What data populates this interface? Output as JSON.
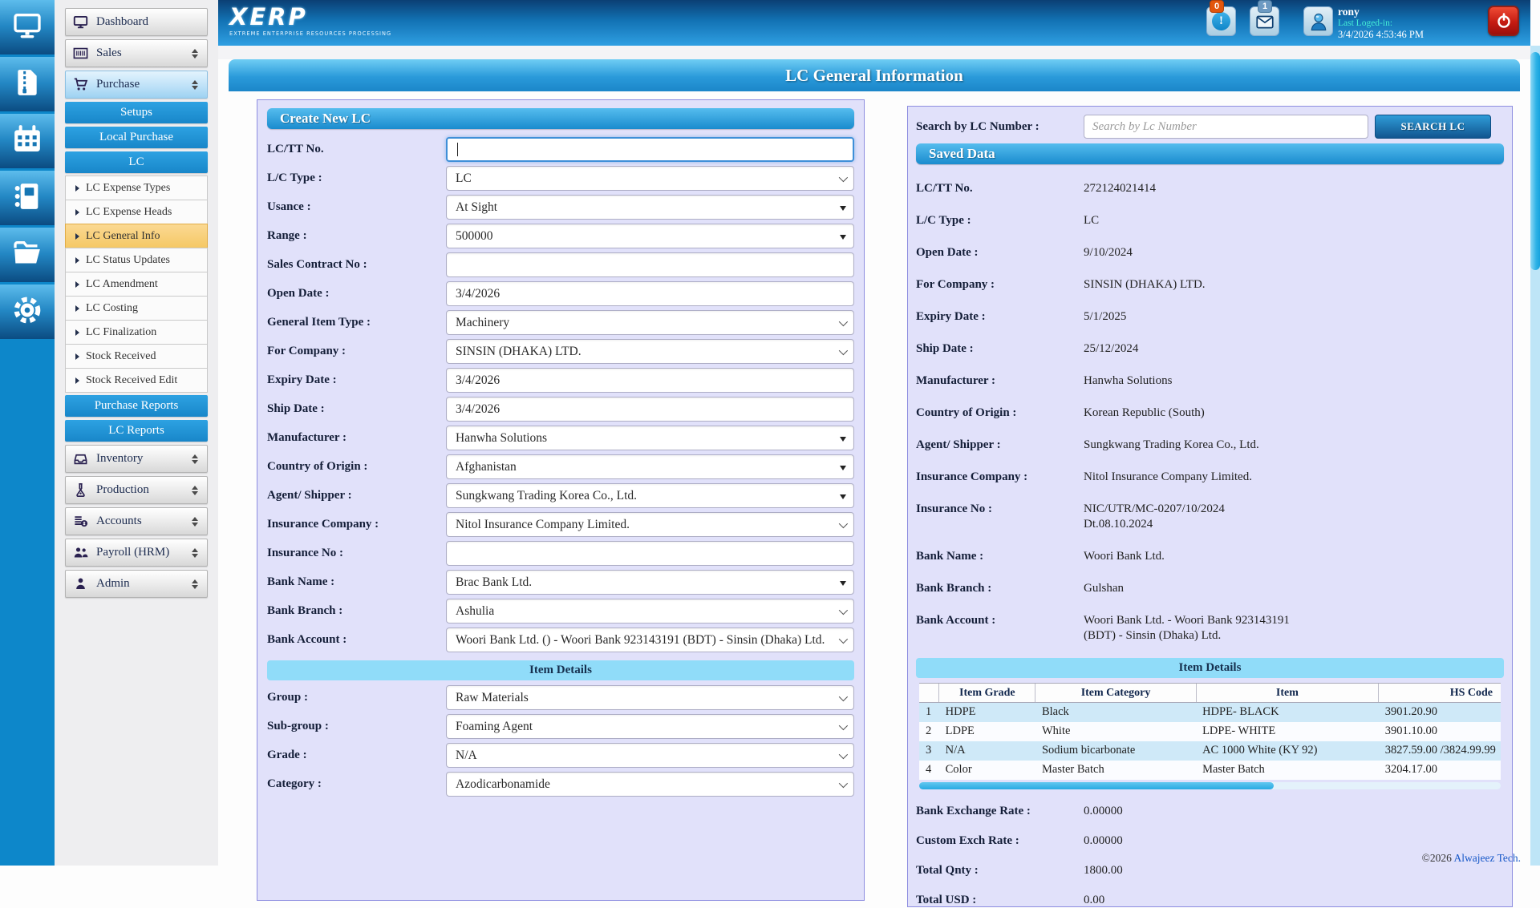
{
  "header": {
    "logo_title": "XERP",
    "logo_subtitle": "EXTREME ENTERPRISE RESOURCES PROCESSING",
    "notification_badge": "0",
    "mail_badge": "1",
    "user": {
      "name": "rony",
      "last_login_label": "Last Loged-in:",
      "last_login_time": "3/4/2026 4:53:46 PM"
    }
  },
  "page_title": "LC General Information",
  "rail_icons": [
    "desktop-icon",
    "zip-file-icon",
    "calendar-icon",
    "notebook-icon",
    "folder-icon",
    "gear-icon"
  ],
  "sidebar": {
    "items": [
      {
        "kind": "module",
        "icon": "monitor-icon",
        "label": "Dashboard",
        "expandable": false
      },
      {
        "kind": "module",
        "icon": "barcode-icon",
        "label": "Sales",
        "expandable": true
      },
      {
        "kind": "module",
        "icon": "cart-icon",
        "label": "Purchase",
        "expandable": true,
        "active": true
      },
      {
        "kind": "section",
        "label": "Setups"
      },
      {
        "kind": "section",
        "label": "Local Purchase"
      },
      {
        "kind": "section",
        "label": "LC"
      },
      {
        "kind": "sub",
        "label": "LC Expense Types"
      },
      {
        "kind": "sub",
        "label": "LC Expense Heads"
      },
      {
        "kind": "sub",
        "label": "LC General Info",
        "active": true
      },
      {
        "kind": "sub",
        "label": "LC Status Updates"
      },
      {
        "kind": "sub",
        "label": "LC Amendment"
      },
      {
        "kind": "sub",
        "label": "LC Costing"
      },
      {
        "kind": "sub",
        "label": "LC Finalization"
      },
      {
        "kind": "sub",
        "label": "Stock Received"
      },
      {
        "kind": "sub",
        "label": "Stock Received Edit"
      },
      {
        "kind": "section",
        "label": "Purchase Reports"
      },
      {
        "kind": "section",
        "label": "LC Reports"
      },
      {
        "kind": "module",
        "icon": "inbox-icon",
        "label": "Inventory",
        "expandable": true
      },
      {
        "kind": "module",
        "icon": "flask-icon",
        "label": "Production",
        "expandable": true
      },
      {
        "kind": "module",
        "icon": "coins-icon",
        "label": "Accounts",
        "expandable": true
      },
      {
        "kind": "module",
        "icon": "people-icon",
        "label": "Payroll (HRM)",
        "expandable": true
      },
      {
        "kind": "module",
        "icon": "person-icon",
        "label": "Admin",
        "expandable": true
      }
    ]
  },
  "create_form": {
    "title": "Create New LC",
    "fields": [
      {
        "label": "LC/TT No.",
        "value": "",
        "control": "text",
        "focused": true
      },
      {
        "label": "L/C Type :",
        "value": "LC",
        "control": "select"
      },
      {
        "label": "Usance :",
        "value": "At Sight",
        "control": "combo"
      },
      {
        "label": "Range :",
        "value": "500000",
        "control": "combo"
      },
      {
        "label": "Sales Contract No :",
        "value": "",
        "control": "text"
      },
      {
        "label": "Open Date :",
        "value": "3/4/2026",
        "control": "text"
      },
      {
        "label": "General Item Type :",
        "value": "Machinery",
        "control": "select"
      },
      {
        "label": "For Company :",
        "value": "SINSIN (DHAKA) LTD.",
        "control": "select"
      },
      {
        "label": "Expiry Date :",
        "value": "3/4/2026",
        "control": "text"
      },
      {
        "label": "Ship Date :",
        "value": "3/4/2026",
        "control": "text"
      },
      {
        "label": "Manufacturer :",
        "value": "Hanwha Solutions",
        "control": "combo"
      },
      {
        "label": "Country of Origin :",
        "value": "Afghanistan",
        "control": "combo"
      },
      {
        "label": "Agent/ Shipper :",
        "value": "Sungkwang Trading Korea Co., Ltd.",
        "control": "combo"
      },
      {
        "label": "Insurance Company :",
        "value": "Nitol Insurance Company Limited.",
        "control": "select"
      },
      {
        "label": "Insurance No :",
        "value": "",
        "control": "text"
      },
      {
        "label": "Bank Name :",
        "value": "Brac Bank Ltd.",
        "control": "combo"
      },
      {
        "label": "Bank Branch :",
        "value": "Ashulia",
        "control": "select"
      },
      {
        "label": "Bank Account :",
        "value": "Woori Bank Ltd. () - Woori Bank 923143191 (BDT) - Sinsin (Dhaka) Ltd.",
        "control": "select"
      },
      {
        "divider": "Item Details"
      },
      {
        "label": "Group :",
        "value": "Raw Materials",
        "control": "select"
      },
      {
        "label": "Sub-group :",
        "value": "Foaming Agent",
        "control": "select"
      },
      {
        "label": "Grade :",
        "value": "N/A",
        "control": "select"
      },
      {
        "label": "Category :",
        "value": "Azodicarbonamide",
        "control": "select"
      }
    ]
  },
  "search": {
    "label": "Search by LC Number :",
    "placeholder": "Search by Lc Number",
    "button": "SEARCH LC"
  },
  "saved_data": {
    "title": "Saved Data",
    "rows": [
      {
        "label": "LC/TT No.",
        "value": "272124021414"
      },
      {
        "label": "L/C Type :",
        "value": "LC"
      },
      {
        "label": "Open Date :",
        "value": "9/10/2024"
      },
      {
        "label": "For Company :",
        "value": "SINSIN (DHAKA) LTD."
      },
      {
        "label": "Expiry Date :",
        "value": "5/1/2025"
      },
      {
        "label": "Ship Date :",
        "value": "25/12/2024"
      },
      {
        "label": "Manufacturer :",
        "value": "Hanwha Solutions"
      },
      {
        "label": "Country of Origin :",
        "value": "Korean Republic (South)"
      },
      {
        "label": "Agent/ Shipper :",
        "value": "Sungkwang Trading Korea Co., Ltd."
      },
      {
        "label": "Insurance Company :",
        "value": "Nitol Insurance Company Limited."
      },
      {
        "label": "Insurance No :",
        "value": "NIC/UTR/MC-0207/10/2024\nDt.08.10.2024"
      },
      {
        "label": "Bank Name :",
        "value": "Woori Bank Ltd."
      },
      {
        "label": "Bank Branch :",
        "value": "Gulshan"
      },
      {
        "label": "Bank Account :",
        "value": "Woori Bank Ltd. - Woori Bank 923143191\n(BDT) - Sinsin (Dhaka) Ltd."
      }
    ],
    "item_details_title": "Item Details",
    "table": {
      "headers": [
        "",
        "Item Grade",
        "Item Category",
        "Item",
        "HS Code"
      ],
      "rows": [
        [
          "1",
          "HDPE",
          "Black",
          "HDPE- BLACK",
          "3901.20.90"
        ],
        [
          "2",
          "LDPE",
          "White",
          "LDPE- WHITE",
          "3901.10.00"
        ],
        [
          "3",
          "N/A",
          "Sodium bicarbonate",
          "AC 1000 White (KY 92)",
          "3827.59.00 /3824.99.99"
        ],
        [
          "4",
          "Color",
          "Master Batch",
          "Master Batch",
          "3204.17.00"
        ]
      ]
    },
    "totals": [
      {
        "label": "Bank Exchange Rate :",
        "value": "0.00000"
      },
      {
        "label": "Custom Exch Rate :",
        "value": "0.00000"
      },
      {
        "label": "Total Qnty :",
        "value": "1800.00"
      },
      {
        "label": "Total USD :",
        "value": "0.00"
      }
    ]
  },
  "footer": {
    "copyright": "©2026",
    "vendor": "Alwajeez Tech."
  },
  "colors": {
    "accent_blue": "#1a8bce",
    "panel_bg": "#e1e1fa",
    "active_item_orange": "#f5c865",
    "badge_orange": "#e2560d",
    "power_red": "#c61c12"
  }
}
